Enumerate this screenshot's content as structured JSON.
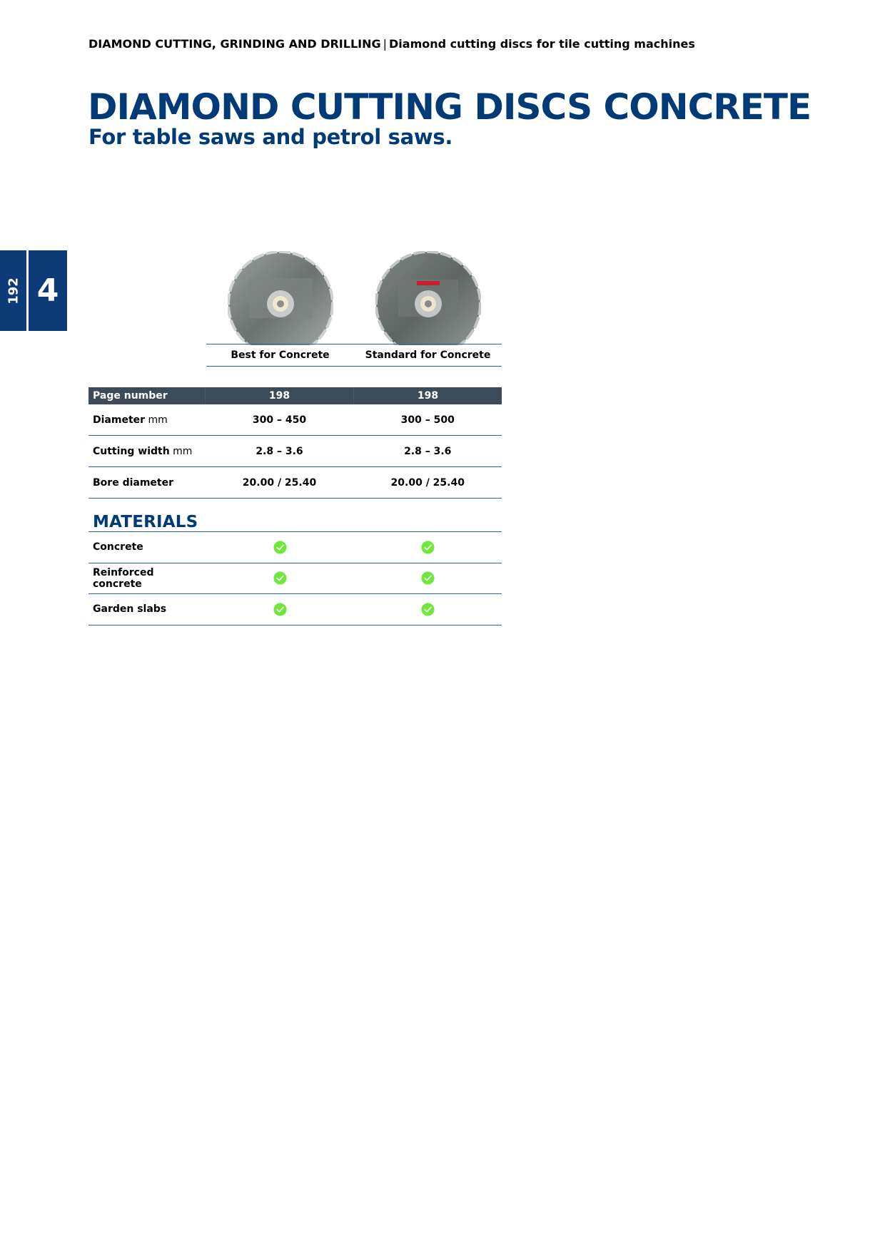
{
  "breadcrumb": {
    "section": "DIAMOND CUTTING, GRINDING AND DRILLING",
    "separator": "|",
    "subsection": "Diamond cutting discs for tile cutting machines"
  },
  "title": "DIAMOND CUTTING DISCS CONCRETE",
  "subtitle": "For table saws and petrol saws.",
  "chapter_tab": {
    "page": "192",
    "chapter": "4",
    "color": "#0d3b78"
  },
  "products": [
    {
      "name": "Best for Concrete",
      "image": "diamond-disc"
    },
    {
      "name": "Standard for Concrete",
      "image": "diamond-disc"
    }
  ],
  "spec_table": {
    "header": {
      "label": "Page number",
      "values": [
        "198",
        "198"
      ]
    },
    "rows": [
      {
        "label": "Diameter",
        "unit": "mm",
        "values": [
          "300 – 450",
          "300 – 500"
        ]
      },
      {
        "label": "Cutting width",
        "unit": "mm",
        "values": [
          "2.8 – 3.6",
          "2.8 – 3.6"
        ]
      },
      {
        "label": "Bore diameter",
        "unit": "",
        "values": [
          "20.00 / 25.40",
          "20.00 / 25.40"
        ]
      }
    ]
  },
  "materials": {
    "title": "MATERIALS",
    "rows": [
      {
        "label": "Concrete",
        "values": [
          "check",
          "check"
        ]
      },
      {
        "label": "Reinforced concrete",
        "values": [
          "check",
          "check"
        ]
      },
      {
        "label": "Garden slabs",
        "values": [
          "check",
          "check"
        ]
      }
    ]
  },
  "colors": {
    "brand_blue": "#003b78",
    "rule_blue": "#2c64a8",
    "table_header": "#3b4b59",
    "check_green": "#6ee83a"
  }
}
